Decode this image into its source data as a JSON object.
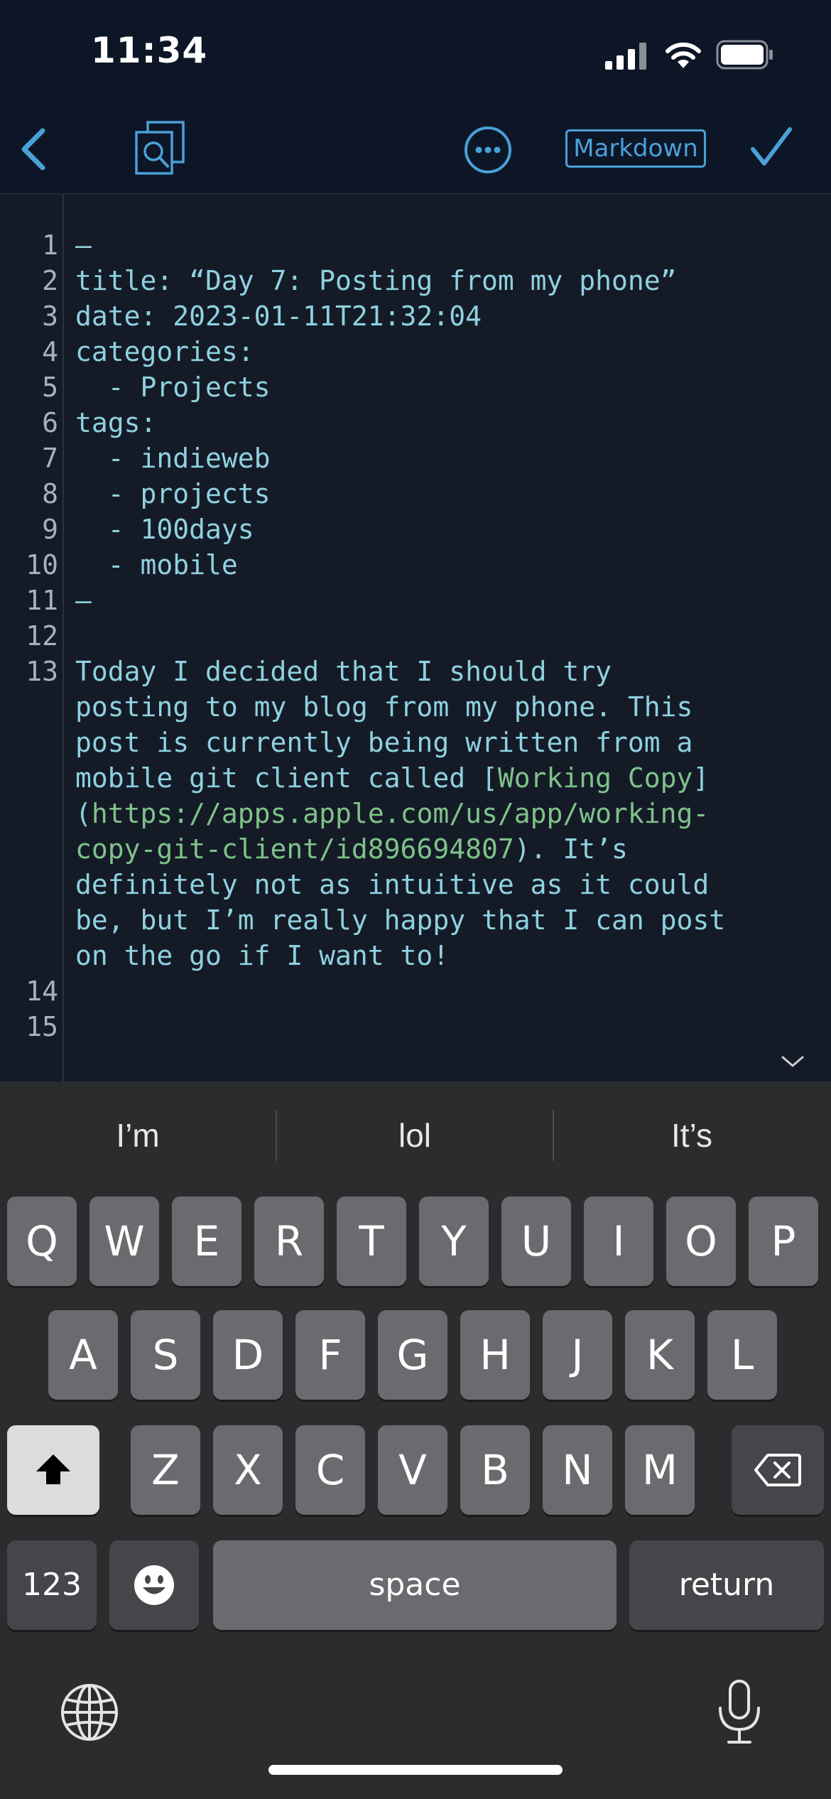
{
  "status": {
    "time": "11:34"
  },
  "toolbar": {
    "format_badge": "Markdown"
  },
  "editor": {
    "lines": [
      {
        "n": "1",
        "segments": [
          {
            "text": "—"
          }
        ]
      },
      {
        "n": "2",
        "segments": [
          {
            "text": "title: “Day 7: Posting from my phone”"
          }
        ]
      },
      {
        "n": "3",
        "segments": [
          {
            "text": "date: 2023-01-11T21:32:04"
          }
        ]
      },
      {
        "n": "4",
        "segments": [
          {
            "text": "categories:"
          }
        ]
      },
      {
        "n": "5",
        "segments": [
          {
            "text": "  - Projects"
          }
        ]
      },
      {
        "n": "6",
        "segments": [
          {
            "text": "tags:"
          }
        ]
      },
      {
        "n": "7",
        "segments": [
          {
            "text": "  - indieweb"
          }
        ]
      },
      {
        "n": "8",
        "segments": [
          {
            "text": "  - projects"
          }
        ]
      },
      {
        "n": "9",
        "segments": [
          {
            "text": "  - 100days"
          }
        ]
      },
      {
        "n": "10",
        "segments": [
          {
            "text": "  - mobile"
          }
        ]
      },
      {
        "n": "11",
        "segments": [
          {
            "text": "—"
          }
        ]
      },
      {
        "n": "12",
        "segments": [
          {
            "text": ""
          }
        ]
      },
      {
        "n": "13",
        "segments": [
          {
            "text": "Today I decided that I should try"
          }
        ]
      },
      {
        "n": "",
        "segments": [
          {
            "text": "posting to my blog from my phone. This"
          }
        ]
      },
      {
        "n": "",
        "segments": [
          {
            "text": "post is currently being written from a"
          }
        ]
      },
      {
        "n": "",
        "segments": [
          {
            "text": "mobile git client called ["
          },
          {
            "text": "Working Copy",
            "link": true
          },
          {
            "text": "]"
          }
        ]
      },
      {
        "n": "",
        "segments": [
          {
            "text": "("
          },
          {
            "text": "https://apps.apple.com/us/app/working-",
            "link": true
          }
        ]
      },
      {
        "n": "",
        "segments": [
          {
            "text": "copy-git-client/id896694807",
            "link": true
          },
          {
            "text": "). It’s"
          }
        ]
      },
      {
        "n": "",
        "segments": [
          {
            "text": "definitely not as intuitive as it could"
          }
        ]
      },
      {
        "n": "",
        "segments": [
          {
            "text": "be, but I’m really happy that I can post"
          }
        ]
      },
      {
        "n": "",
        "segments": [
          {
            "text": "on the go if I want to!"
          }
        ]
      },
      {
        "n": "14",
        "segments": [
          {
            "text": ""
          }
        ]
      },
      {
        "n": "15",
        "segments": [
          {
            "text": ""
          }
        ]
      }
    ]
  },
  "keyboard": {
    "suggestions": [
      "I’m",
      "lol",
      "It’s"
    ],
    "row1": [
      "Q",
      "W",
      "E",
      "R",
      "T",
      "Y",
      "U",
      "I",
      "O",
      "P"
    ],
    "row2": [
      "A",
      "S",
      "D",
      "F",
      "G",
      "H",
      "J",
      "K",
      "L"
    ],
    "row3": [
      "Z",
      "X",
      "C",
      "V",
      "B",
      "N",
      "M"
    ],
    "numbers_label": "123",
    "space_label": "space",
    "return_label": "return"
  },
  "icons": [
    "back-chevron-icon",
    "search-documents-icon",
    "more-icon",
    "checkmark-icon",
    "chevron-down-icon",
    "shift-icon",
    "delete-icon",
    "emoji-icon",
    "globe-icon",
    "microphone-icon",
    "signal-icon",
    "wifi-icon",
    "battery-icon"
  ]
}
